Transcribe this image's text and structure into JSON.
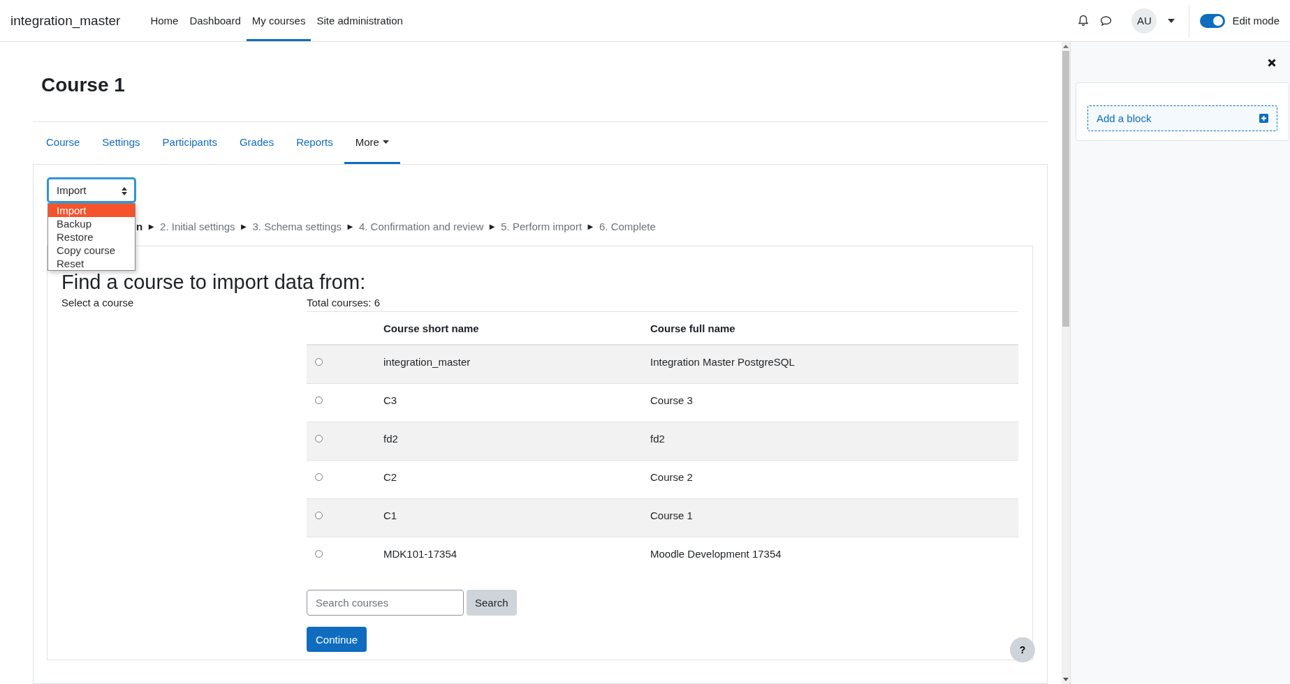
{
  "navbar": {
    "site_name": "integration_master",
    "items": [
      {
        "label": "Home",
        "selected": false
      },
      {
        "label": "Dashboard",
        "selected": false
      },
      {
        "label": "My courses",
        "selected": true
      },
      {
        "label": "Site administration",
        "selected": false
      }
    ],
    "avatar": "AU",
    "edit_mode": {
      "label": "Edit mode",
      "on": true
    }
  },
  "page": {
    "title": "Course 1",
    "tabs": [
      {
        "label": "Course",
        "selected": false
      },
      {
        "label": "Settings",
        "selected": false
      },
      {
        "label": "Participants",
        "selected": false
      },
      {
        "label": "Grades",
        "selected": false
      },
      {
        "label": "Reports",
        "selected": false
      },
      {
        "label": "More",
        "selected": true
      }
    ],
    "select": {
      "value": "Import",
      "options": [
        {
          "label": "Import",
          "selected": true
        },
        {
          "label": "Backup",
          "selected": false
        },
        {
          "label": "Restore",
          "selected": false
        },
        {
          "label": "Copy course",
          "selected": false
        },
        {
          "label": "Reset",
          "selected": false
        }
      ]
    },
    "steps": [
      {
        "label": "n",
        "current": true
      },
      {
        "label": "2. Initial settings",
        "current": false
      },
      {
        "label": "3. Schema settings",
        "current": false
      },
      {
        "label": "4. Confirmation and review",
        "current": false
      },
      {
        "label": "5. Perform import",
        "current": false
      },
      {
        "label": "6. Complete",
        "current": false
      }
    ],
    "step_separator": "►",
    "heading": "Find a course to import data from:",
    "select_label": "Select a course",
    "total": "Total courses: 6",
    "table": {
      "columns": [
        "Course short name",
        "Course full name"
      ],
      "rows": [
        {
          "short": "integration_master",
          "full": "Integration Master PostgreSQL",
          "selected": false
        },
        {
          "short": "C3",
          "full": "Course 3",
          "selected": false
        },
        {
          "short": "fd2",
          "full": "fd2",
          "selected": false
        },
        {
          "short": "C2",
          "full": "Course 2",
          "selected": false
        },
        {
          "short": "C1",
          "full": "Course 1",
          "selected": false
        },
        {
          "short": "MDK101-17354",
          "full": "Moodle Development 17354",
          "selected": false
        }
      ]
    },
    "search": {
      "placeholder": "Search courses",
      "button": "Search"
    },
    "continue": "Continue",
    "help": "?"
  },
  "drawer": {
    "add_block": "Add a block"
  }
}
